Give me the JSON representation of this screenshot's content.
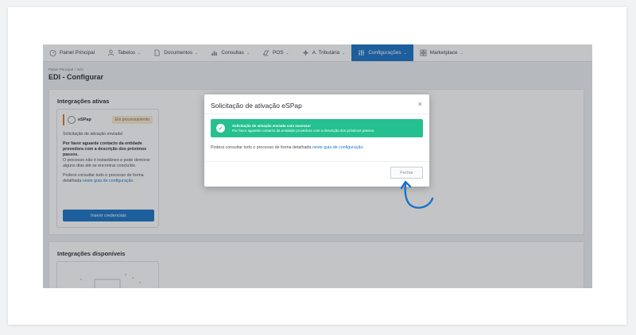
{
  "nav": {
    "items": [
      {
        "label": "Painel Principal",
        "icon": "dashboard-icon",
        "has_menu": false,
        "active": false
      },
      {
        "label": "Tabelos",
        "icon": "people-icon",
        "has_menu": true,
        "active": false
      },
      {
        "label": "Documentos",
        "icon": "document-icon",
        "has_menu": true,
        "active": false
      },
      {
        "label": "Consultas",
        "icon": "chart-icon",
        "has_menu": true,
        "active": false
      },
      {
        "label": "POS",
        "icon": "pos-icon",
        "has_menu": true,
        "active": false
      },
      {
        "label": "A. Tributária",
        "icon": "tax-icon",
        "has_menu": true,
        "active": false
      },
      {
        "label": "Configurações",
        "icon": "settings-icon",
        "has_menu": true,
        "active": true
      },
      {
        "label": "Marketplace",
        "icon": "grid-icon",
        "has_menu": true,
        "active": false
      }
    ],
    "chevron": "⌄"
  },
  "breadcrumb": {
    "root": "Painel Principal",
    "separator": "/",
    "current": "EDI"
  },
  "page": {
    "title": "EDI - Configurar"
  },
  "active_section": {
    "title": "Integrações ativas",
    "card": {
      "logo_text": "eSPap",
      "name": "eSPap",
      "badge": "Em processamento",
      "status_line": "Solicitação de ativação enviada!",
      "bold_text": "Por favor aguarde contacto da entidade provedora com a descrição dos próximos passos.",
      "note": "O processo não é instantâneo e pode demorar alguns dias até se encontrar concluído.",
      "guide_prefix": "Poderá consultar todo o processo de forma detalhada",
      "guide_link": "neste guia de configuração",
      "guide_suffix": ".",
      "button": "Inserir credenciais"
    }
  },
  "available_section": {
    "title": "Integrações disponíveis"
  },
  "modal": {
    "title": "Solicitação de ativação eSPap",
    "close": "×",
    "alert_title": "Solicitação de ativação enviada com sucesso!",
    "alert_body": "Por favor aguarde contacto da entidade provedora com a descrição dos próximos passos.",
    "body_prefix": "Poderá consultar todo o processo de forma detalhada",
    "body_link": "neste guia de configuração",
    "body_suffix": ".",
    "close_button": "Fechar"
  },
  "colors": {
    "accent": "#1a73c7",
    "success": "#24c08f",
    "badge_bg": "#f6ead8",
    "annotation_arrow": "#1a73c7"
  }
}
